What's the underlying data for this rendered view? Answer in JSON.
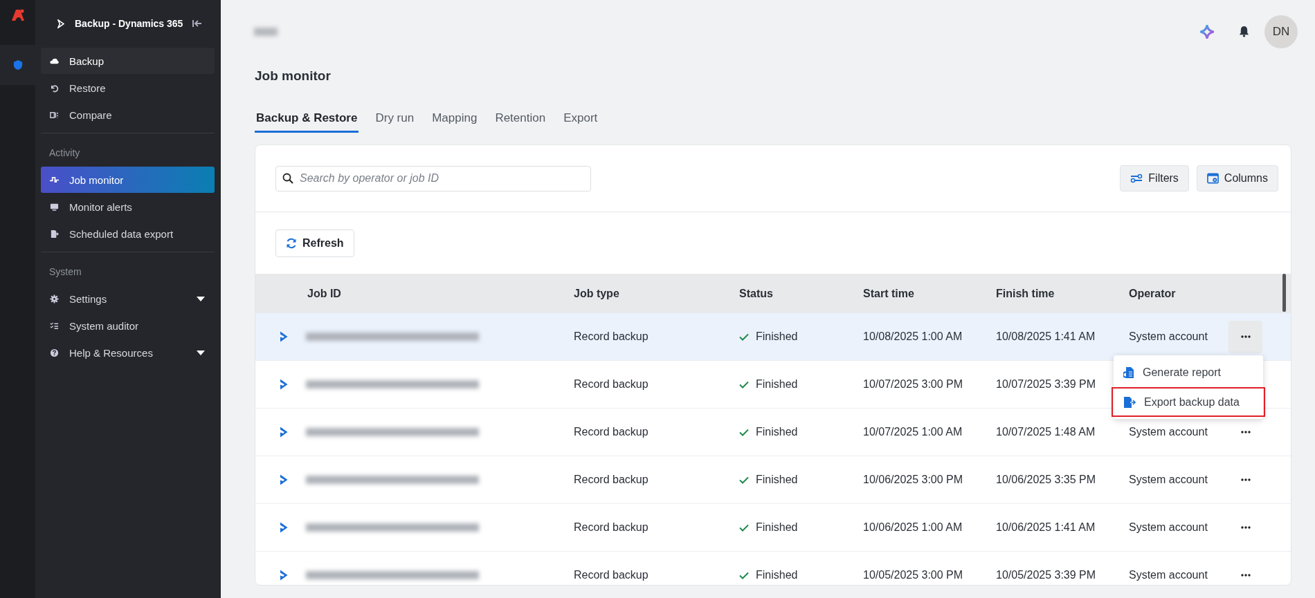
{
  "sidebar": {
    "title": "Backup - Dynamics 365",
    "sections": [
      {
        "items": [
          {
            "label": "Backup",
            "selected": false,
            "highlighted": true,
            "expandable": false
          },
          {
            "label": "Restore",
            "selected": false,
            "highlighted": false,
            "expandable": false
          },
          {
            "label": "Compare",
            "selected": false,
            "highlighted": false,
            "expandable": false
          }
        ]
      },
      {
        "heading": "Activity",
        "items": [
          {
            "label": "Job monitor",
            "selected": true,
            "highlighted": false,
            "expandable": false
          },
          {
            "label": "Monitor alerts",
            "selected": false,
            "highlighted": false,
            "expandable": false
          },
          {
            "label": "Scheduled data export",
            "selected": false,
            "highlighted": false,
            "expandable": false
          }
        ]
      },
      {
        "heading": "System",
        "items": [
          {
            "label": "Settings",
            "selected": false,
            "highlighted": false,
            "expandable": true
          },
          {
            "label": "System auditor",
            "selected": false,
            "highlighted": false,
            "expandable": false
          },
          {
            "label": "Help & Resources",
            "selected": false,
            "highlighted": false,
            "expandable": true
          }
        ]
      }
    ]
  },
  "header": {
    "avatar": "DN"
  },
  "page_title": "Job monitor",
  "tabs": [
    {
      "label": "Backup & Restore",
      "selected": true
    },
    {
      "label": "Dry run",
      "selected": false
    },
    {
      "label": "Mapping",
      "selected": false
    },
    {
      "label": "Retention",
      "selected": false
    },
    {
      "label": "Export",
      "selected": false
    }
  ],
  "search": {
    "placeholder": "Search by operator or job ID"
  },
  "toolbar_buttons": [
    "Filters",
    "Columns"
  ],
  "refresh_button": "Refresh",
  "table": {
    "columns": [
      "Job ID",
      "Job type",
      "Status",
      "Start time",
      "Finish time",
      "Operator"
    ],
    "rows": [
      {
        "selected": true,
        "menu_open": true,
        "job_type": "Record backup",
        "status": "Finished",
        "start": "10/08/2025 1:00 AM",
        "finish": "10/08/2025 1:41 AM",
        "operator": "System account"
      },
      {
        "selected": false,
        "job_type": "Record backup",
        "status": "Finished",
        "start": "10/07/2025 3:00 PM",
        "finish": "10/07/2025 3:39 PM"
      },
      {
        "selected": false,
        "job_type": "Record backup",
        "status": "Finished",
        "start": "10/07/2025 1:00 AM",
        "finish": "10/07/2025 1:48 AM",
        "operator": "System account"
      },
      {
        "selected": false,
        "job_type": "Record backup",
        "status": "Finished",
        "start": "10/06/2025 3:00 PM",
        "finish": "10/06/2025 3:35 PM",
        "operator": "System account"
      },
      {
        "selected": false,
        "job_type": "Record backup",
        "status": "Finished",
        "start": "10/06/2025 1:00 AM",
        "finish": "10/06/2025 1:41 AM",
        "operator": "System account"
      },
      {
        "selected": false,
        "job_type": "Record backup",
        "status": "Finished",
        "start": "10/05/2025 3:00 PM",
        "finish": "10/05/2025 3:39 PM",
        "operator": "System account"
      }
    ]
  },
  "context_menu": [
    {
      "label": "Generate report",
      "outlined": false
    },
    {
      "label": "Export backup data",
      "outlined": true
    }
  ]
}
